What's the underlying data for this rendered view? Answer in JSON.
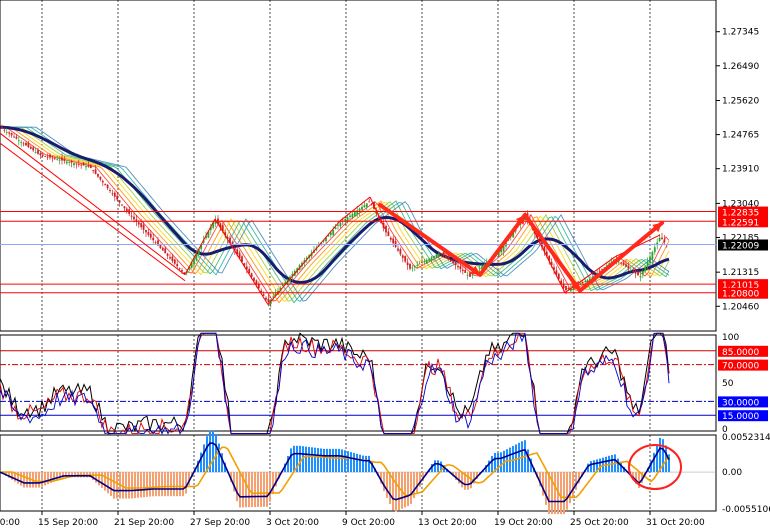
{
  "chart_data": [
    {
      "type": "candlestick",
      "panel": "price",
      "y_ticks": [
        "1.27345",
        "1.26490",
        "1.25620",
        "1.24765",
        "1.23910",
        "1.23040",
        "1.22185",
        "1.21315",
        "1.20460"
      ],
      "y_tick_values": [
        1.27345,
        1.2649,
        1.2562,
        1.24765,
        1.2391,
        1.2304,
        1.22185,
        1.21315,
        1.2046
      ],
      "ylim": [
        1.1989,
        1.2809
      ],
      "x_ticks": [
        "15 Sep 20:00",
        "21 Sep 20:00",
        "27 Sep 20:00",
        "3 Oct 20:00",
        "9 Oct 20:00",
        "13 Oct 20:00",
        "19 Oct 20:00",
        "25 Oct 20:00",
        "31 Oct 20:00"
      ],
      "x_tick_edge_fragment": "20:00",
      "current_price": {
        "label": "1.22009",
        "value": 1.22009
      },
      "horizontal_levels": [
        {
          "label": "1.22835",
          "value": 1.22835
        },
        {
          "label": "1.22591",
          "value": 1.22591
        },
        {
          "label": "1.21015",
          "value": 1.21015
        },
        {
          "label": "1.20800",
          "value": 1.208
        }
      ],
      "colors": {
        "level": "#ff0000",
        "arrow": "#ff2a1a",
        "ma": "#1a1a6e",
        "bull": "#2aa42a",
        "bear": "#cc2222"
      }
    },
    {
      "type": "line",
      "panel": "oscillator",
      "y_ticks": [
        "100",
        "50",
        "0"
      ],
      "ylim": [
        0,
        100
      ],
      "levels": [
        {
          "label": "85.0000",
          "value": 85
        },
        {
          "label": "70.0000",
          "value": 70
        },
        {
          "label": "30.0000",
          "value": 30
        },
        {
          "label": "15.0000",
          "value": 15
        }
      ]
    },
    {
      "type": "bar",
      "panel": "macd",
      "y_ticks": [
        "0.0052314",
        "0.00",
        "-0.0055106"
      ],
      "ylim": [
        -0.0055106,
        0.0052314
      ],
      "colors": {
        "positive": "#1e90ff",
        "negative": "#f4a070",
        "signal": "#f0a000",
        "main": "#00008b"
      }
    }
  ]
}
